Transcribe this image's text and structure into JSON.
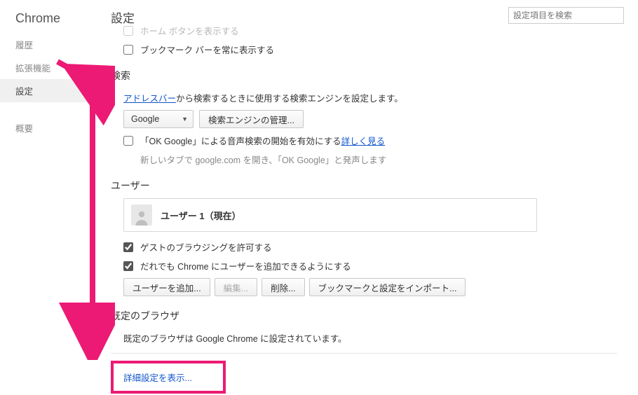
{
  "app_name": "Chrome",
  "sidebar": {
    "items": [
      {
        "label": "履歴"
      },
      {
        "label": "拡張機能"
      },
      {
        "label": "設定"
      },
      {
        "label": "概要"
      }
    ]
  },
  "header": {
    "title": "設定",
    "search_placeholder": "設定項目を検索"
  },
  "startup": {
    "show_home_button_label": "ホーム ボタンを表示する",
    "show_bookmarks_bar_label": "ブックマーク バーを常に表示する"
  },
  "search": {
    "heading": "検索",
    "address_bar_link": "アドレスバー",
    "description_tail": " から検索するときに使用する検索エンジンを設定します。",
    "engine_selected": "Google",
    "manage_engines_button": "検索エンジンの管理...",
    "ok_google_label": "「OK Google」による音声検索の開始を有効にする ",
    "ok_google_link": "詳しく見る",
    "ok_google_hint": "新しいタブで google.com を開き、「OK Google」と発声します"
  },
  "users": {
    "heading": "ユーザー",
    "current_user": "ユーザー 1（現在）",
    "allow_guest_label": "ゲストのブラウジングを許可する",
    "allow_add_user_label": "だれでも Chrome にユーザーを追加できるようにする",
    "buttons": {
      "add": "ユーザーを追加...",
      "edit": "編集...",
      "delete": "削除...",
      "import": "ブックマークと設定をインポート..."
    }
  },
  "default_browser": {
    "heading": "既定のブラウザ",
    "status": "既定のブラウザは Google Chrome に設定されています。"
  },
  "advanced": {
    "link": "詳細設定を表示..."
  }
}
